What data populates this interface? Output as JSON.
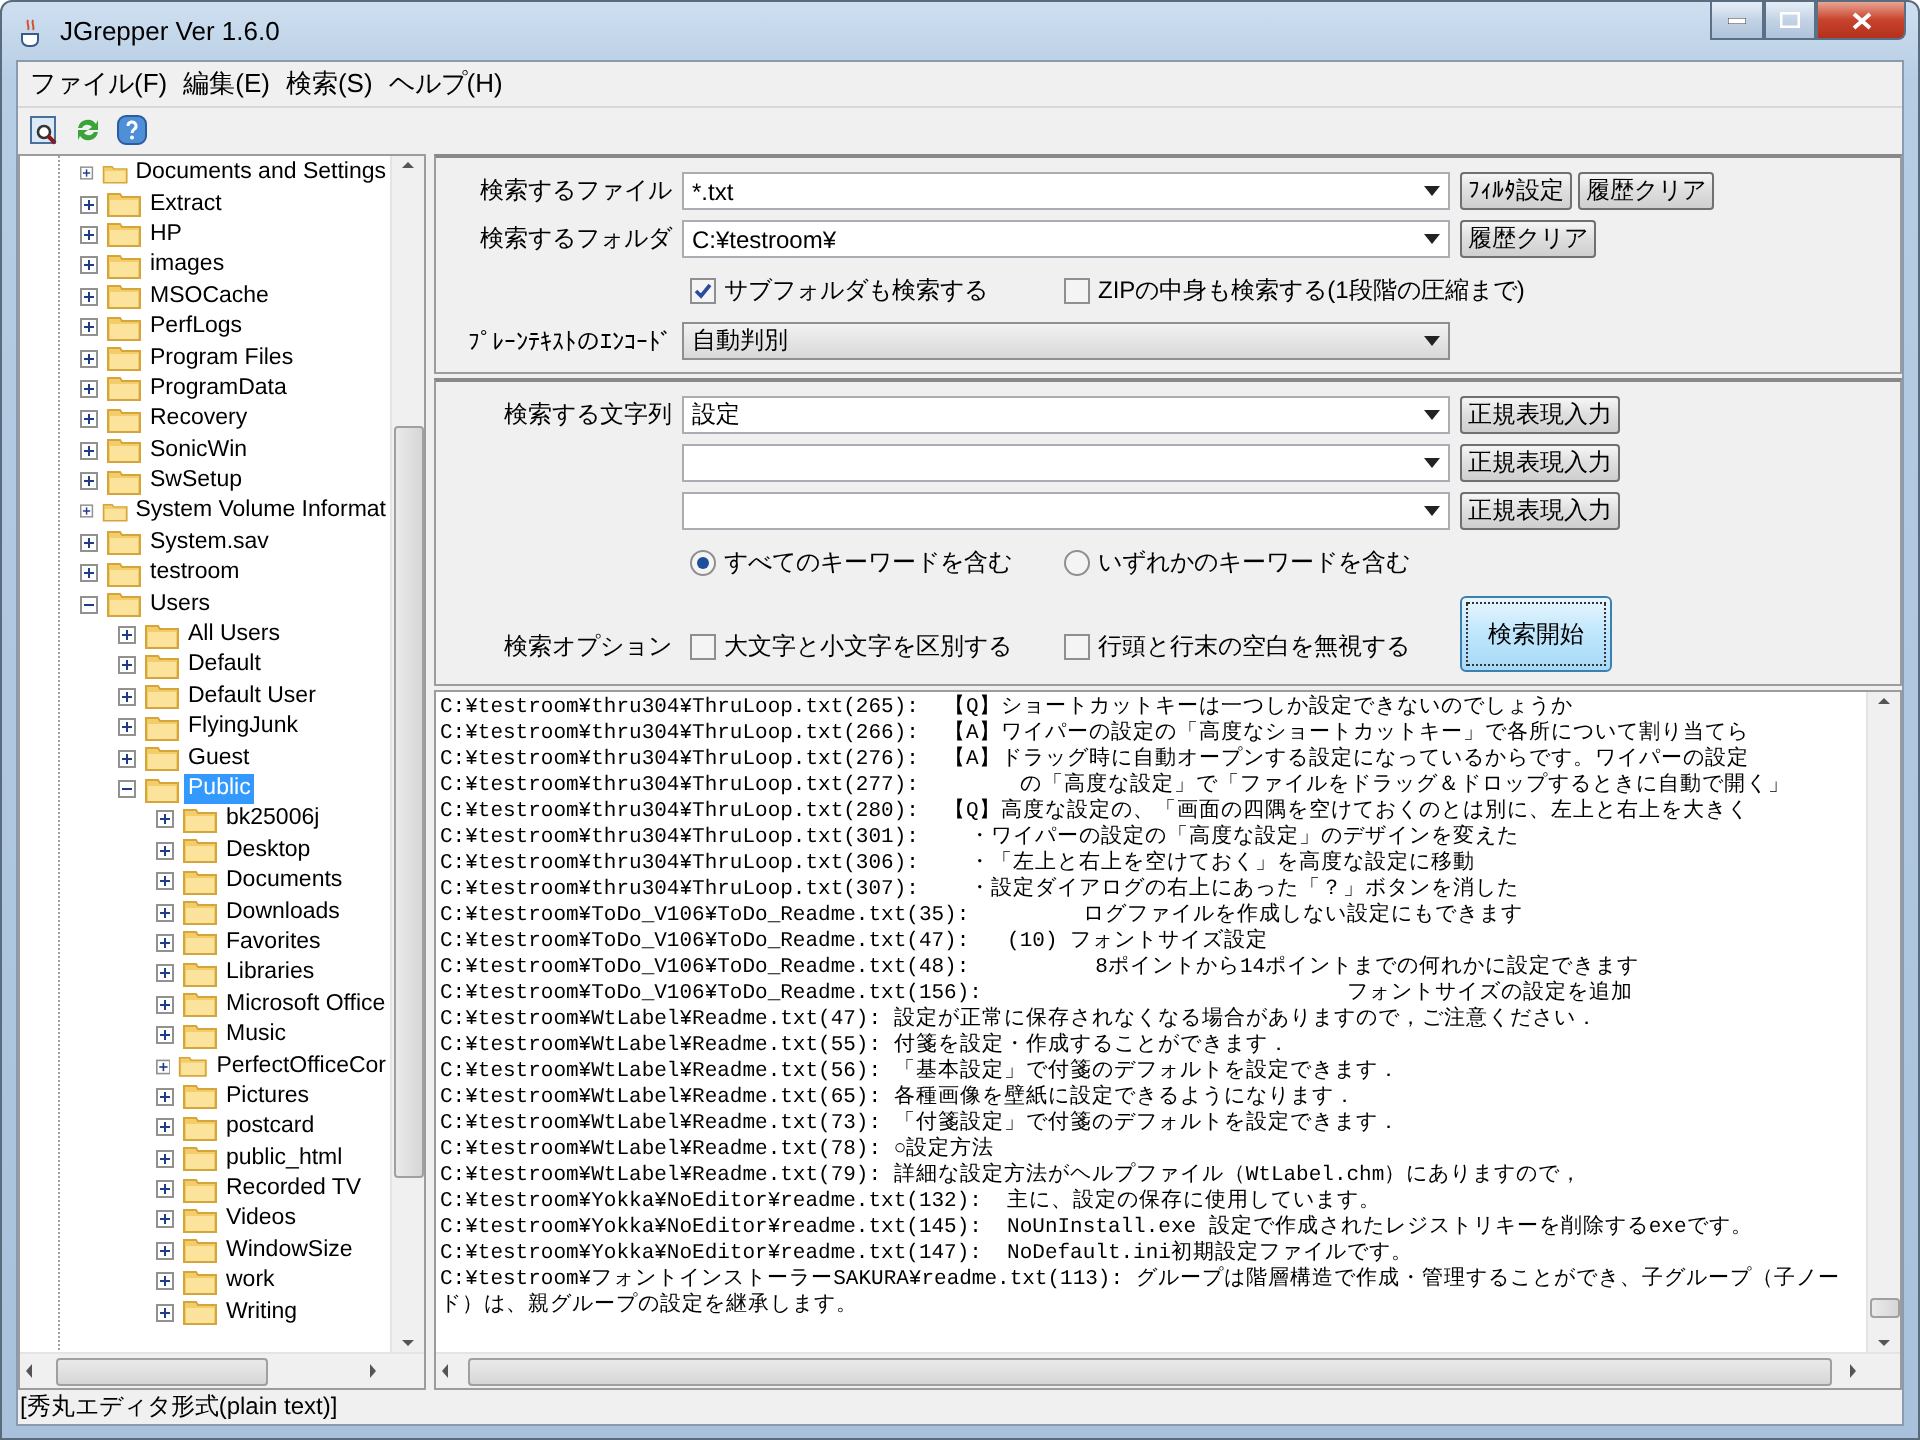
{
  "window": {
    "title": "JGrepper Ver 1.6.0"
  },
  "menu": [
    "ファイル(F)",
    "編集(E)",
    "検索(S)",
    "ヘルプ(H)"
  ],
  "tree": {
    "items": [
      {
        "label": "Documents and Settings",
        "expanded": false,
        "selected": false
      },
      {
        "label": "Extract",
        "expanded": false,
        "selected": false
      },
      {
        "label": "HP",
        "expanded": false,
        "selected": false
      },
      {
        "label": "images",
        "expanded": false,
        "selected": false
      },
      {
        "label": "MSOCache",
        "expanded": false,
        "selected": false
      },
      {
        "label": "PerfLogs",
        "expanded": false,
        "selected": false
      },
      {
        "label": "Program Files",
        "expanded": false,
        "selected": false
      },
      {
        "label": "ProgramData",
        "expanded": false,
        "selected": false
      },
      {
        "label": "Recovery",
        "expanded": false,
        "selected": false
      },
      {
        "label": "SonicWin",
        "expanded": false,
        "selected": false
      },
      {
        "label": "SwSetup",
        "expanded": false,
        "selected": false
      },
      {
        "label": "System Volume Informat",
        "expanded": false,
        "selected": false
      },
      {
        "label": "System.sav",
        "expanded": false,
        "selected": false
      },
      {
        "label": "testroom",
        "expanded": false,
        "selected": false
      },
      {
        "label": "Users",
        "expanded": true,
        "selected": false,
        "children": [
          {
            "label": "All Users",
            "expanded": false,
            "selected": false
          },
          {
            "label": "Default",
            "expanded": false,
            "selected": false
          },
          {
            "label": "Default User",
            "expanded": false,
            "selected": false
          },
          {
            "label": "FlyingJunk",
            "expanded": false,
            "selected": false
          },
          {
            "label": "Guest",
            "expanded": false,
            "selected": false
          },
          {
            "label": "Public",
            "expanded": true,
            "selected": true,
            "children": [
              {
                "label": "bk25006j",
                "expanded": false,
                "selected": false
              },
              {
                "label": "Desktop",
                "expanded": false,
                "selected": false
              },
              {
                "label": "Documents",
                "expanded": false,
                "selected": false
              },
              {
                "label": "Downloads",
                "expanded": false,
                "selected": false
              },
              {
                "label": "Favorites",
                "expanded": false,
                "selected": false
              },
              {
                "label": "Libraries",
                "expanded": false,
                "selected": false
              },
              {
                "label": "Microsoft Office",
                "expanded": false,
                "selected": false
              },
              {
                "label": "Music",
                "expanded": false,
                "selected": false
              },
              {
                "label": "PerfectOfficeCor",
                "expanded": false,
                "selected": false
              },
              {
                "label": "Pictures",
                "expanded": false,
                "selected": false
              },
              {
                "label": "postcard",
                "expanded": false,
                "selected": false
              },
              {
                "label": "public_html",
                "expanded": false,
                "selected": false
              },
              {
                "label": "Recorded TV",
                "expanded": false,
                "selected": false
              },
              {
                "label": "Videos",
                "expanded": false,
                "selected": false
              },
              {
                "label": "WindowSize",
                "expanded": false,
                "selected": false
              },
              {
                "label": "work",
                "expanded": false,
                "selected": false
              },
              {
                "label": "Writing",
                "expanded": false,
                "selected": false
              }
            ]
          }
        ]
      }
    ]
  },
  "form": {
    "file": {
      "label": "検索するファイル",
      "value": "*.txt",
      "buttons": [
        "ﾌｨﾙﾀ設定",
        "履歴クリア"
      ]
    },
    "folder": {
      "label": "検索するフォルダ",
      "value": "C:¥testroom¥",
      "buttons": [
        "履歴クリア"
      ]
    },
    "folder_options": [
      {
        "label": "サブフォルダも検索する",
        "checked": true
      },
      {
        "label": "ZIPの中身も検索する(1段階の圧縮まで)",
        "checked": false
      }
    ],
    "encoding": {
      "label": "ﾌﾟﾚｰﾝﾃｷｽﾄのｴﾝｺｰﾄﾞ",
      "value": "自動判別"
    },
    "search_strings": {
      "label": "検索する文字列",
      "rows": [
        {
          "value": "設定",
          "button": "正規表現入力"
        },
        {
          "button": "正規表現入力"
        },
        {
          "button": "正規表現入力"
        }
      ]
    },
    "match_mode": [
      {
        "label": "すべてのキーワードを含む",
        "selected": true
      },
      {
        "label": "いずれかのキーワードを含む",
        "selected": false
      }
    ],
    "search_options": {
      "label": "検索オプション",
      "items": [
        {
          "label": "大文字と小文字を区別する",
          "checked": false
        },
        {
          "label": "行頭と行末の空白を無視する",
          "checked": false
        }
      ]
    },
    "search_button": "検索開始"
  },
  "results": [
    "C:¥testroom¥thru304¥ThruLoop.txt(265):  【Q】ショートカットキーは一つしか設定できないのでしょうか",
    "C:¥testroom¥thru304¥ThruLoop.txt(266):  【A】ワイパーの設定の「高度なショートカットキー」で各所について割り当てら",
    "C:¥testroom¥thru304¥ThruLoop.txt(276):  【A】ドラッグ時に自動オープンする設定になっているからです。ワイパーの設定",
    "C:¥testroom¥thru304¥ThruLoop.txt(277):        の「高度な設定」で「ファイルをドラッグ＆ドロップするときに自動で開く」",
    "C:¥testroom¥thru304¥ThruLoop.txt(280):  【Q】高度な設定の、「画面の四隅を空けておくのとは別に、左上と右上を大きく",
    "C:¥testroom¥thru304¥ThruLoop.txt(301):    ・ワイパーの設定の「高度な設定」のデザインを変えた",
    "C:¥testroom¥thru304¥ThruLoop.txt(306):    ・「左上と右上を空けておく」を高度な設定に移動",
    "C:¥testroom¥thru304¥ThruLoop.txt(307):    ・設定ダイアログの右上にあった「？」ボタンを消した",
    "C:¥testroom¥ToDo_V106¥ToDo_Readme.txt(35):         ログファイルを作成しない設定にもできます",
    "C:¥testroom¥ToDo_V106¥ToDo_Readme.txt(47):   (10) フォントサイズ設定",
    "C:¥testroom¥ToDo_V106¥ToDo_Readme.txt(48):          8ポイントから14ポイントまでの何れかに設定できます",
    "C:¥testroom¥ToDo_V106¥ToDo_Readme.txt(156):                             フォントサイズの設定を追加",
    "C:¥testroom¥WtLabel¥Readme.txt(47): 設定が正常に保存されなくなる場合がありますので，ご注意ください．",
    "C:¥testroom¥WtLabel¥Readme.txt(55): 付箋を設定・作成することができます．",
    "C:¥testroom¥WtLabel¥Readme.txt(56): 「基本設定」で付箋のデフォルトを設定できます．",
    "C:¥testroom¥WtLabel¥Readme.txt(65): 各種画像を壁紙に設定できるようになります．",
    "C:¥testroom¥WtLabel¥Readme.txt(73): 「付箋設定」で付箋のデフォルトを設定できます．",
    "C:¥testroom¥WtLabel¥Readme.txt(78): ○設定方法",
    "C:¥testroom¥WtLabel¥Readme.txt(79): 詳細な設定方法がヘルプファイル（WtLabel.chm）にありますので，",
    "C:¥testroom¥Yokka¥NoEditor¥readme.txt(132):  主に、設定の保存に使用しています。",
    "C:¥testroom¥Yokka¥NoEditor¥readme.txt(145):  NoUnInstall.exe 設定で作成されたレジストリキーを削除するexeです。",
    "C:¥testroom¥Yokka¥NoEditor¥readme.txt(147):  NoDefault.ini初期設定ファイルです。",
    "C:¥testroom¥フォントインストーラーSAKURA¥readme.txt(113): グループは階層構造で作成・管理することができ、子グループ（子ノード）は、親グループの設定を継承します。"
  ],
  "status_bar": "[秀丸エディタ形式(plain text)]"
}
